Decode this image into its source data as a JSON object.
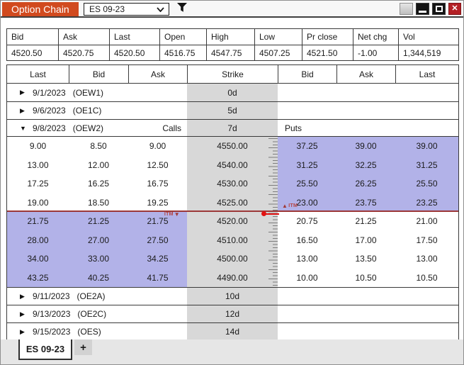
{
  "titlebar": {
    "title": "Option Chain",
    "symbol": "ES 09-23",
    "icons": {
      "filter": "funnel",
      "combo_chevron": "chevron-down",
      "close": "✕"
    }
  },
  "quote_bar": {
    "fields": [
      {
        "label": "Bid",
        "value": "4520.50"
      },
      {
        "label": "Ask",
        "value": "4520.75"
      },
      {
        "label": "Last",
        "value": "4520.50"
      },
      {
        "label": "Open",
        "value": "4516.75"
      },
      {
        "label": "High",
        "value": "4547.75"
      },
      {
        "label": "Low",
        "value": "4507.25"
      },
      {
        "label": "Pr close",
        "value": "4521.50"
      },
      {
        "label": "Net chg",
        "value": "-1.00"
      },
      {
        "label": "Vol",
        "value": "1,344,519"
      }
    ]
  },
  "chain": {
    "headers": [
      "Last",
      "Bid",
      "Ask",
      "Strike",
      "Bid",
      "Ask",
      "Last"
    ],
    "arrow_collapsed": "▶",
    "arrow_expanded": "▼",
    "itm_label": "ITM",
    "itm_marker_down": "▼",
    "itm_marker_up": "▲",
    "groups_above": [
      {
        "date": "9/1/2023",
        "code": "(OEW1)",
        "dte": "0d"
      },
      {
        "date": "9/6/2023",
        "code": "(OE1C)",
        "dte": "5d"
      }
    ],
    "expanded_group": {
      "date": "9/8/2023",
      "code": "(OEW2)",
      "dte": "7d",
      "calls_label": "Calls",
      "puts_label": "Puts"
    },
    "rows": [
      {
        "strike": "4550.00",
        "c_last": "9.00",
        "c_bid": "8.50",
        "c_ask": "9.00",
        "p_bid": "37.25",
        "p_ask": "39.00",
        "p_last": "39.00"
      },
      {
        "strike": "4540.00",
        "c_last": "13.00",
        "c_bid": "12.00",
        "c_ask": "12.50",
        "p_bid": "31.25",
        "p_ask": "32.25",
        "p_last": "31.25"
      },
      {
        "strike": "4530.00",
        "c_last": "17.25",
        "c_bid": "16.25",
        "c_ask": "16.75",
        "p_bid": "25.50",
        "p_ask": "26.25",
        "p_last": "25.50"
      },
      {
        "strike": "4525.00",
        "c_last": "19.00",
        "c_bid": "18.50",
        "c_ask": "19.25",
        "p_bid": "23.00",
        "p_ask": "23.75",
        "p_last": "23.25"
      },
      {
        "strike": "4520.00",
        "c_last": "21.75",
        "c_bid": "21.25",
        "c_ask": "21.75",
        "p_bid": "20.75",
        "p_ask": "21.25",
        "p_last": "21.00"
      },
      {
        "strike": "4510.00",
        "c_last": "28.00",
        "c_bid": "27.00",
        "c_ask": "27.50",
        "p_bid": "16.50",
        "p_ask": "17.00",
        "p_last": "17.50"
      },
      {
        "strike": "4500.00",
        "c_last": "34.00",
        "c_bid": "33.00",
        "c_ask": "34.25",
        "p_bid": "13.00",
        "p_ask": "13.50",
        "p_last": "13.00"
      },
      {
        "strike": "4490.00",
        "c_last": "43.25",
        "c_bid": "40.25",
        "c_ask": "41.75",
        "p_bid": "10.00",
        "p_ask": "10.50",
        "p_last": "10.50"
      }
    ],
    "groups_below": [
      {
        "date": "9/11/2023",
        "code": "(OE2A)",
        "dte": "10d"
      },
      {
        "date": "9/13/2023",
        "code": "(OE2C)",
        "dte": "12d"
      },
      {
        "date": "9/15/2023",
        "code": "(OES)",
        "dte": "14d"
      }
    ]
  },
  "tab_bar": {
    "active_tab": "ES 09-23",
    "new_tab": "+"
  },
  "colors": {
    "accent_orange": "#d14a1e",
    "itm_highlight": "#b2b2e8",
    "strike_band": "#d8d8d8",
    "price_line": "#9c3838",
    "price_marker": "#e11212",
    "close_button": "#b42025"
  }
}
